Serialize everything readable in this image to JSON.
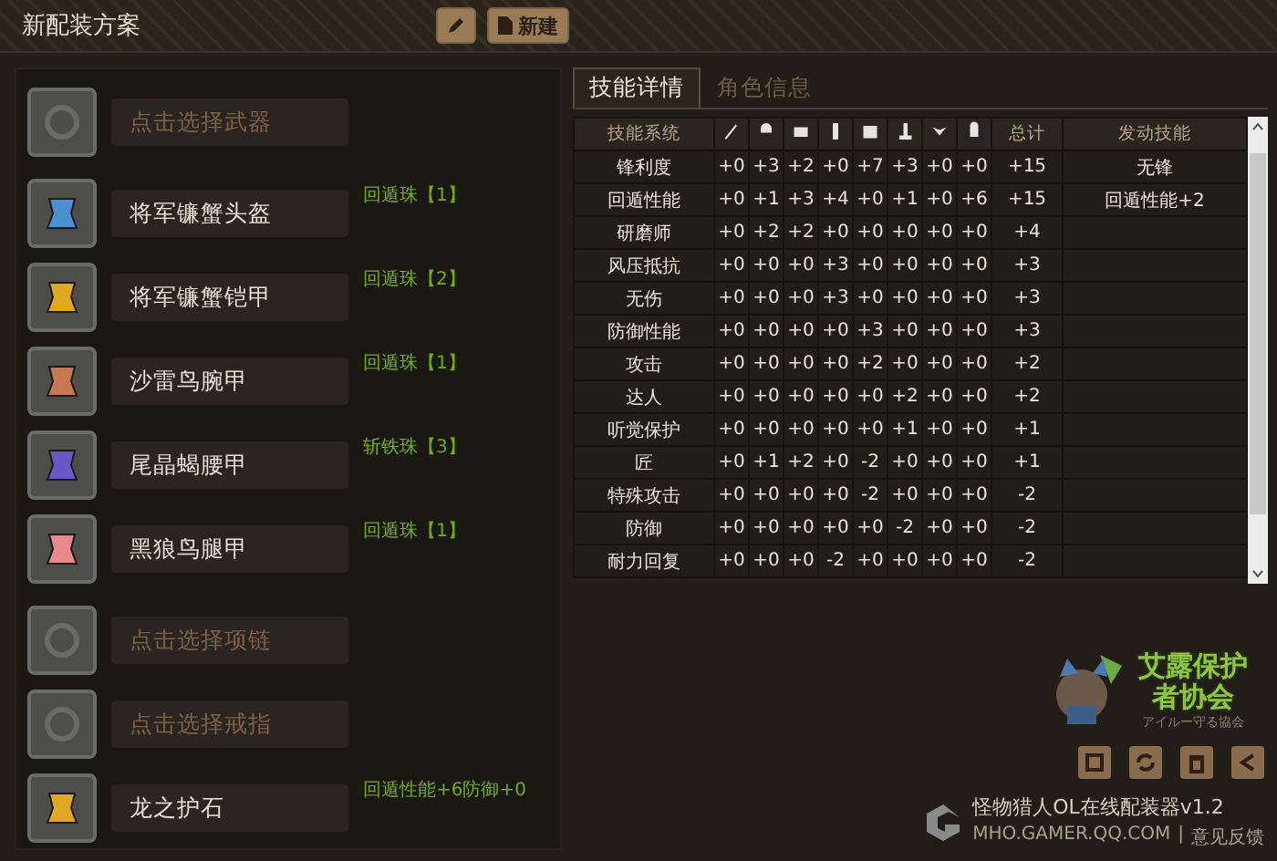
{
  "header": {
    "title": "新配装方案",
    "buttons": [
      {
        "kind": "edit"
      },
      {
        "kind": "new",
        "label": "新建"
      }
    ]
  },
  "slot_groups": [
    [
      {
        "kind": "empty",
        "label": "点击选择武器"
      }
    ],
    [
      {
        "kind": "equipped",
        "label": "将军镰蟹头盔",
        "gems": "回遁珠【1】"
      },
      {
        "kind": "equipped",
        "label": "将军镰蟹铠甲",
        "gems": "回遁珠【2】"
      },
      {
        "kind": "equipped",
        "label": "沙雷鸟腕甲",
        "gems": "回遁珠【1】"
      },
      {
        "kind": "equipped",
        "label": "尾晶蝎腰甲",
        "gems": "斩铁珠【3】"
      },
      {
        "kind": "equipped",
        "label": "黑狼鸟腿甲",
        "gems": "回遁珠【1】"
      }
    ],
    [
      {
        "kind": "empty",
        "label": "点击选择项链"
      },
      {
        "kind": "empty",
        "label": "点击选择戒指"
      },
      {
        "kind": "equipped",
        "label": "龙之护石",
        "gems": "回遁性能+6防御+0"
      }
    ]
  ],
  "tabs": [
    {
      "label": "技能详情",
      "selected": true
    },
    {
      "label": "角色信息",
      "selected": false
    }
  ],
  "table": {
    "columns": [
      {
        "kind": "text",
        "label": "技能系统"
      },
      {
        "kind": "icon"
      },
      {
        "kind": "icon"
      },
      {
        "kind": "icon"
      },
      {
        "kind": "icon"
      },
      {
        "kind": "icon"
      },
      {
        "kind": "icon"
      },
      {
        "kind": "icon"
      },
      {
        "kind": "icon"
      },
      {
        "kind": "text",
        "label": "总计"
      },
      {
        "kind": "text",
        "label": "发动技能"
      }
    ],
    "rows": [
      {
        "skill": "锋利度",
        "values": [
          "+0",
          "+3",
          "+2",
          "+0",
          "+7",
          "+3",
          "+0",
          "+0"
        ],
        "total": "+15",
        "active": "无锋"
      },
      {
        "skill": "回遁性能",
        "values": [
          "+0",
          "+1",
          "+3",
          "+4",
          "+0",
          "+1",
          "+0",
          "+6"
        ],
        "total": "+15",
        "active": "回遁性能+2"
      },
      {
        "skill": "研磨师",
        "values": [
          "+0",
          "+2",
          "+2",
          "+0",
          "+0",
          "+0",
          "+0",
          "+0"
        ],
        "total": "+4"
      },
      {
        "skill": "风压抵抗",
        "values": [
          "+0",
          "+0",
          "+0",
          "+3",
          "+0",
          "+0",
          "+0",
          "+0"
        ],
        "total": "+3"
      },
      {
        "skill": "无伤",
        "values": [
          "+0",
          "+0",
          "+0",
          "+3",
          "+0",
          "+0",
          "+0",
          "+0"
        ],
        "total": "+3"
      },
      {
        "skill": "防御性能",
        "values": [
          "+0",
          "+0",
          "+0",
          "+0",
          "+3",
          "+0",
          "+0",
          "+0"
        ],
        "total": "+3"
      },
      {
        "skill": "攻击",
        "values": [
          "+0",
          "+0",
          "+0",
          "+0",
          "+2",
          "+0",
          "+0",
          "+0"
        ],
        "total": "+2"
      },
      {
        "skill": "达人",
        "values": [
          "+0",
          "+0",
          "+0",
          "+0",
          "+0",
          "+2",
          "+0",
          "+0"
        ],
        "total": "+2"
      },
      {
        "skill": "听觉保护",
        "values": [
          "+0",
          "+0",
          "+0",
          "+0",
          "+0",
          "+1",
          "+0",
          "+0"
        ],
        "total": "+1"
      },
      {
        "skill": "匠",
        "values": [
          "+0",
          "+1",
          "+2",
          "+0",
          "-2",
          "+0",
          "+0",
          "+0"
        ],
        "total": "+1"
      },
      {
        "skill": "特殊攻击",
        "values": [
          "+0",
          "+0",
          "+0",
          "+0",
          "-2",
          "+0",
          "+0",
          "+0"
        ],
        "total": "-2"
      },
      {
        "skill": "防御",
        "values": [
          "+0",
          "+0",
          "+0",
          "+0",
          "+0",
          "-2",
          "+0",
          "+0"
        ],
        "total": "-2"
      },
      {
        "skill": "耐力回复",
        "values": [
          "+0",
          "+0",
          "+0",
          "-2",
          "+0",
          "+0",
          "+0",
          "+0"
        ],
        "total": "-2"
      }
    ]
  },
  "logo": {
    "title": "艾露保护者协会",
    "subtitle": "アイルー守る協会"
  },
  "toolbar": [
    {
      "kind": "print"
    },
    {
      "kind": "refresh"
    },
    {
      "kind": "delete"
    },
    {
      "kind": "share"
    }
  ],
  "footer": {
    "app_name": "怪物猎人OL在线配装器v1.2",
    "site": "MHO.GAMER.QQ.COM",
    "separator": "|",
    "feedback": "意见反馈"
  }
}
